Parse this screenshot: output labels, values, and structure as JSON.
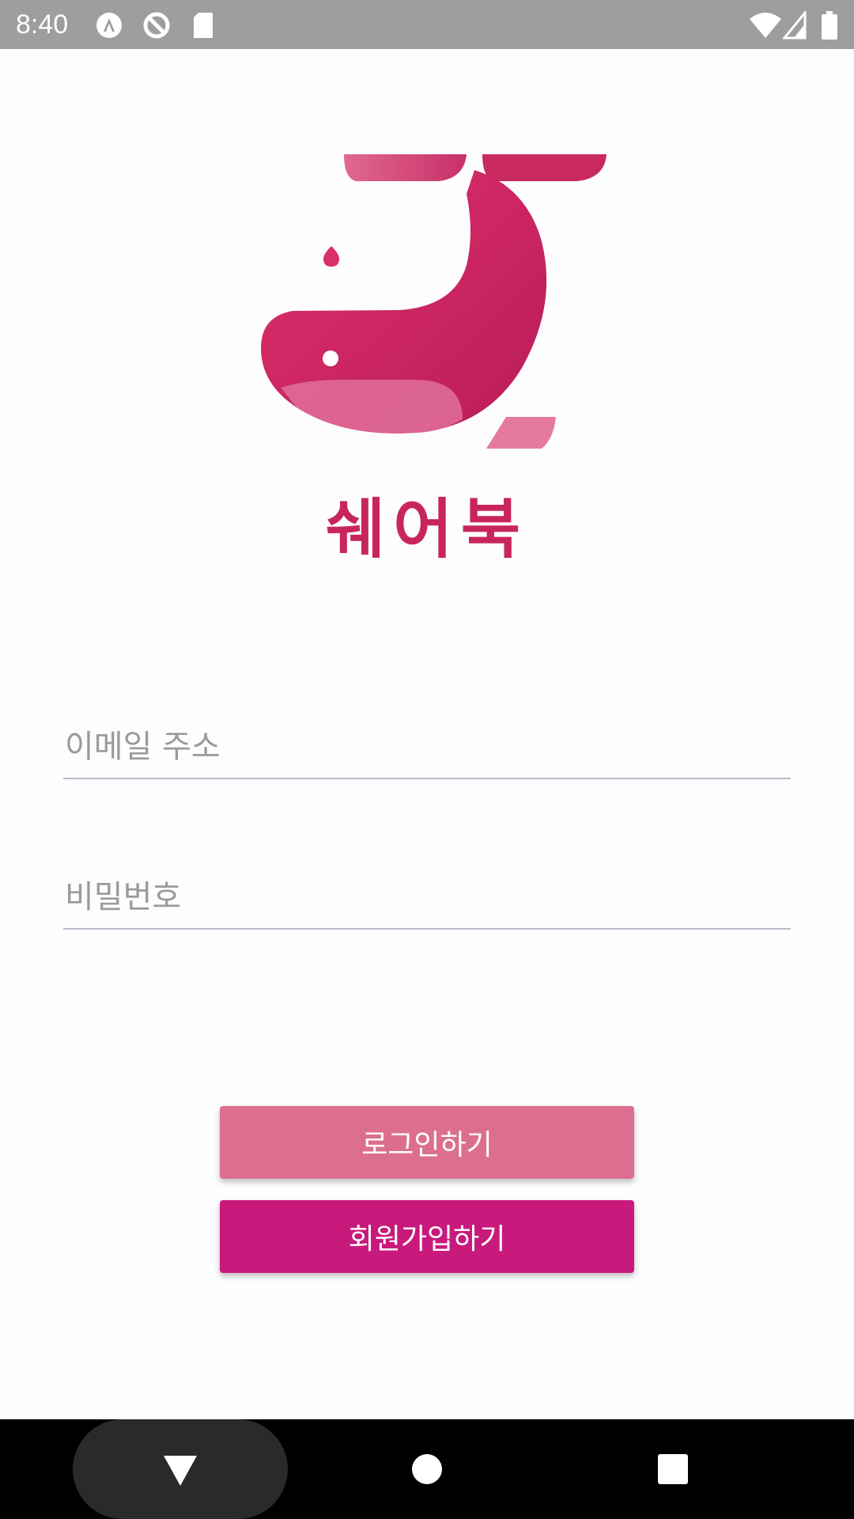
{
  "status_bar": {
    "time": "8:40",
    "left_icons": [
      "app-notification-icon",
      "sync-notification-icon",
      "sd-card-icon"
    ],
    "right_icons": [
      "wifi-icon",
      "cell-signal-icon",
      "battery-icon"
    ]
  },
  "logo": {
    "icon": "whale-logo-icon"
  },
  "app_title": "쉐어북",
  "email": {
    "placeholder": "이메일 주소",
    "value": ""
  },
  "password": {
    "placeholder": "비밀번호",
    "value": ""
  },
  "buttons": {
    "login_label": "로그인하기",
    "signup_label": "회원가입하기"
  },
  "nav_bar": {
    "back_icon": "back-triangle-icon",
    "home_icon": "home-circle-icon",
    "recents_icon": "recents-square-icon"
  },
  "colors": {
    "brand": "#c8265a",
    "login_button": "#dc6f8f",
    "signup_button": "#c81a7c",
    "status_bar": "#9e9e9e",
    "background": "#fdfdfe"
  }
}
